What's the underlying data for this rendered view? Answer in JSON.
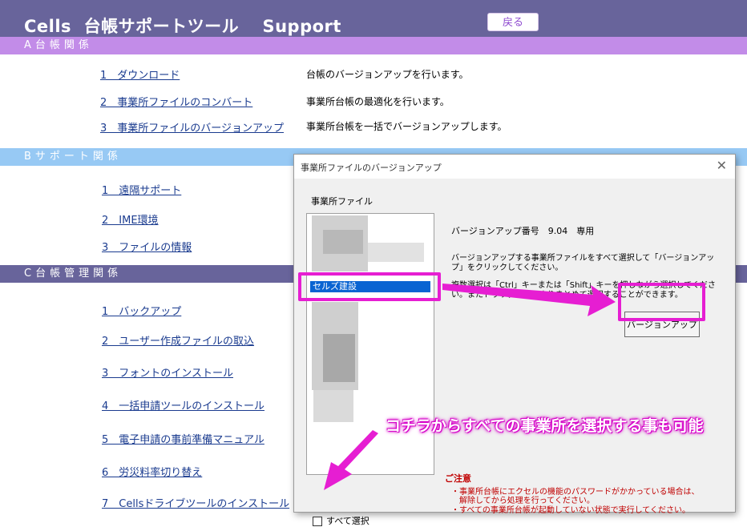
{
  "header": {
    "title": "Cells  台帳サポートツール　 Support",
    "back_label": "戻る"
  },
  "sections": {
    "a": "A台帳関係",
    "b": "Bサポート関係",
    "c": "C台帳管理関係"
  },
  "section_a_items": [
    {
      "label": "1　ダウンロード",
      "desc": "台帳のバージョンアップを行います。"
    },
    {
      "label": "2　事業所ファイルのコンバート",
      "desc": "事業所台帳の最適化を行います。"
    },
    {
      "label": "3　事業所ファイルのバージョンアップ",
      "desc": "事業所台帳を一括でバージョンアップします。"
    }
  ],
  "section_b_items": [
    {
      "label": "1　遠隔サポート"
    },
    {
      "label": "2　IME環境"
    },
    {
      "label": "3　ファイルの情報"
    }
  ],
  "section_c_items": [
    {
      "label": "1　バックアップ"
    },
    {
      "label": "2　ユーザー作成ファイルの取込"
    },
    {
      "label": "3　フォントのインストール"
    },
    {
      "label": "4　一括申請ツールのインストール"
    },
    {
      "label": "5　電子申請の事前準備マニュアル"
    },
    {
      "label": "6　労災料率切り替え"
    },
    {
      "label": "7　Cellsドライブツールのインストール"
    }
  ],
  "dialog": {
    "title": "事業所ファイルのバージョンアップ",
    "close_icon": "close-icon",
    "list_label": "事業所ファイル",
    "selected_item": "セルズ建設",
    "version_label": "バージョンアップ番号　9.04　専用",
    "instruction_1": "バージョンアップする事業所ファイルをすべて選択して「バージョンアップ」をクリックしてください。",
    "instruction_2": "複数選択は「Ctrl」キーまたは「Shift」キーを押しながら選択してください。またドラッグ操作によりまとめて選択することができます。",
    "upgrade_button": "バージョンアップ",
    "caution_title": "ご注意",
    "caution_lines": [
      "・事業所台帳にエクセルの機能のパスワードがかかっている場合は、",
      "　解除してから処理を行ってください。",
      "・すべての事業所台帳が起動していない状態で実行してください。"
    ],
    "select_all_label": "すべて選択"
  },
  "callout": "コチラからすべての事業所を選択する事も可能",
  "colors": {
    "header_bg": "#68649b",
    "section_a": "#c28ce8",
    "section_b": "#97c9f4",
    "highlight": "#e61ed2",
    "link": "#1a3b8f",
    "caution": "#c00000"
  }
}
